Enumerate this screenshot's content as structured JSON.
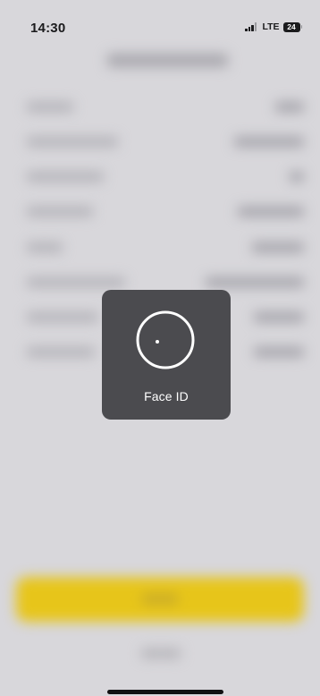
{
  "status_bar": {
    "time": "14:30",
    "network": "LTE",
    "battery_level": "24"
  },
  "faceid": {
    "label": "Face ID",
    "icon": "face-id-scan-icon"
  },
  "colors": {
    "background": "#d8d7db",
    "hud": "#4b4b4f",
    "accent_button": "#e7c51a"
  }
}
